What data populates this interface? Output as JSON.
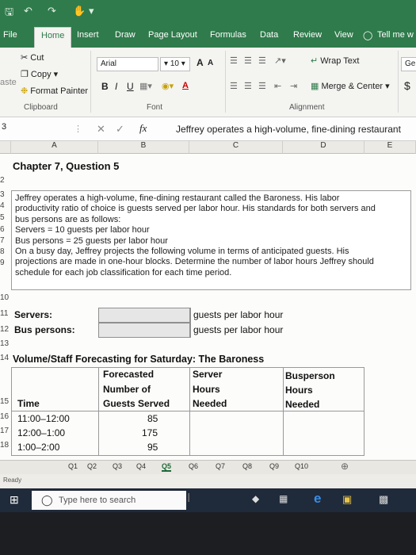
{
  "quick_access": {
    "save_glyph": "🖫",
    "undo_glyph": "↶",
    "redo_glyph": "↷",
    "customize_glyph": "▾"
  },
  "tabs": [
    "File",
    "Home",
    "Insert",
    "Draw",
    "Page Layout",
    "Formulas",
    "Data",
    "Review",
    "View"
  ],
  "tell_me": "Tell me w",
  "clipboard": {
    "cut": "Cut",
    "copy": "Copy",
    "format_painter": "Format Painter",
    "paste": "aste",
    "group": "Clipboard"
  },
  "font": {
    "name": "Arial",
    "size": "10",
    "bold": "B",
    "italic": "I",
    "underline": "U",
    "grow": "A",
    "shrink": "A",
    "fill": "A",
    "group": "Font"
  },
  "alignment": {
    "wrap_text": "Wrap Text",
    "merge_center": "Merge & Center",
    "group": "Alignment"
  },
  "number": {
    "general": "Ge",
    "currency": "$"
  },
  "formula_bar": {
    "name_box": "3",
    "fx": "fx",
    "content": "Jeffrey operates a high-volume, fine-dining restaurant"
  },
  "columns": [
    "A",
    "B",
    "C",
    "D",
    "E"
  ],
  "rows": [
    "2",
    "3",
    "4",
    "5",
    "6",
    "7",
    "8",
    "9",
    "10",
    "11",
    "12",
    "13",
    "14",
    "15",
    "16",
    "17",
    "18"
  ],
  "sheet": {
    "title": "Chapter 7, Question 5",
    "paragraph": [
      "Jeffrey operates a high-volume, fine-dining restaurant called the Baroness. His labor",
      "productivity ratio of choice is guests served per labor hour. His standards for both servers and",
      "bus persons are as follows:",
      "Servers = 10 guests per labor hour",
      "Bus persons = 25 guests per labor hour",
      "On a busy day, Jeffrey projects the following volume in terms of anticipated guests. His",
      "projections are made in one-hour blocks. Determine the number of labor hours Jeffrey should",
      "schedule for each job classification for each time period."
    ],
    "servers_label": "Servers:",
    "bus_label": "Bus persons:",
    "unit_text": "guests per labor hour",
    "table_title": "Volume/Staff Forecasting for Saturday: The Baroness",
    "headers": {
      "time": "Time",
      "forecast": [
        "Forecasted",
        "Number of",
        "Guests Served"
      ],
      "server": [
        "Server",
        "Hours",
        "Needed"
      ],
      "bus": [
        "Busperson",
        "Hours",
        "Needed"
      ]
    },
    "data_rows": [
      {
        "time": "11:00–12:00",
        "guests": "85"
      },
      {
        "time": "12:00–1:00",
        "guests": "175"
      },
      {
        "time": "1:00–2:00",
        "guests": "95"
      }
    ]
  },
  "sheet_tabs": [
    "Q1",
    "Q2",
    "Q3",
    "Q4",
    "Q5",
    "Q6",
    "Q7",
    "Q8",
    "Q9",
    "Q10"
  ],
  "active_sheet": "Q5",
  "status": "Ready",
  "taskbar": {
    "search_placeholder": "Type here to search"
  },
  "colors": {
    "excel_green": "#2f7b4b",
    "taskbar": "#1f2a3a"
  }
}
